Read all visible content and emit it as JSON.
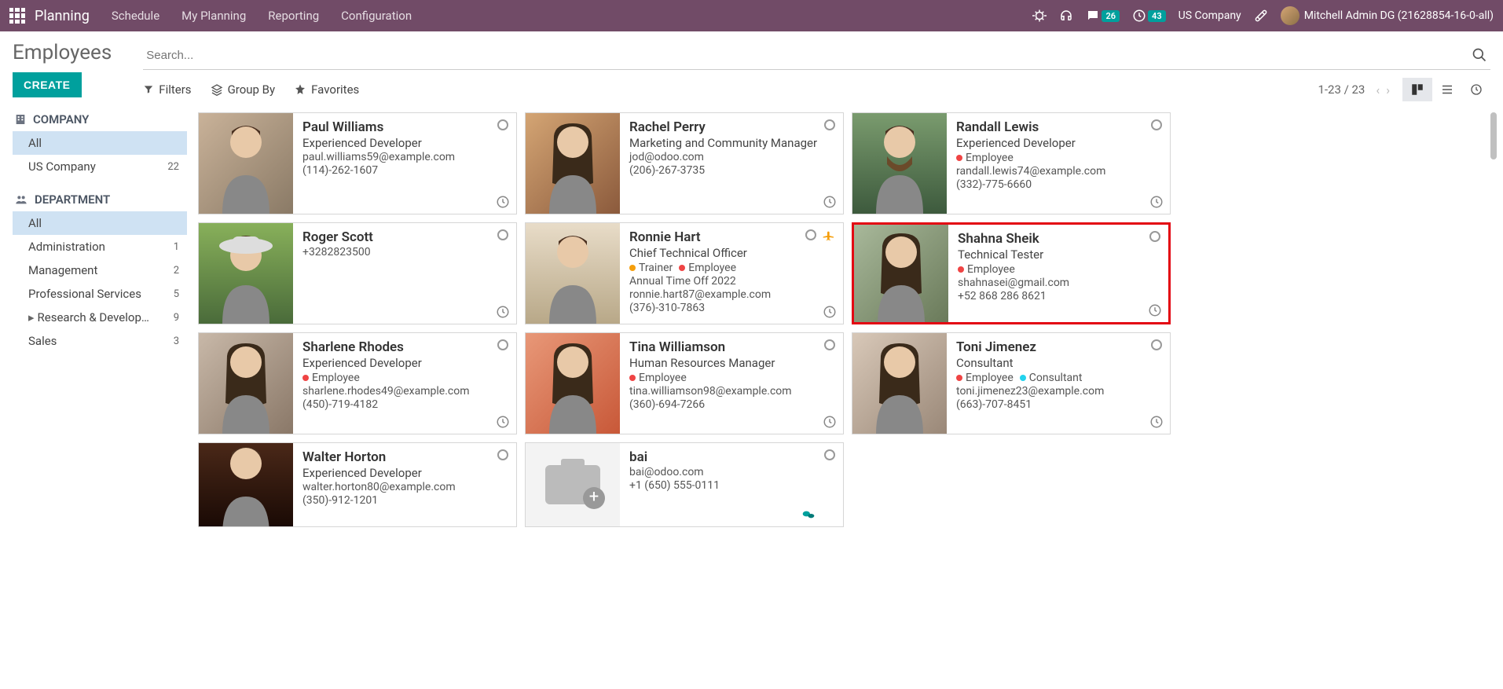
{
  "topnav": {
    "brand": "Planning",
    "menus": [
      "Schedule",
      "My Planning",
      "Reporting",
      "Configuration"
    ],
    "badge_chat": "26",
    "badge_clock": "43",
    "company": "US Company",
    "user": "Mitchell Admin DG (21628854-16-0-all)"
  },
  "page": {
    "title": "Employees",
    "create_label": "CREATE",
    "search_placeholder": "Search...",
    "filters_label": "Filters",
    "groupby_label": "Group By",
    "favorites_label": "Favorites",
    "pager": "1-23 / 23"
  },
  "sidebar": {
    "company_heading": "COMPANY",
    "company_all": "All",
    "company_items": [
      {
        "label": "US Company",
        "count": "22"
      }
    ],
    "department_heading": "DEPARTMENT",
    "department_all": "All",
    "department_items": [
      {
        "label": "Administration",
        "count": "1"
      },
      {
        "label": "Management",
        "count": "2"
      },
      {
        "label": "Professional Services",
        "count": "5"
      },
      {
        "label": "Research & Develop…",
        "count": "9",
        "expandable": true
      },
      {
        "label": "Sales",
        "count": "3"
      }
    ]
  },
  "employees": [
    {
      "name": "Paul Williams",
      "title": "Experienced Developer",
      "tags": [],
      "lines": [
        "paul.williams59@example.com",
        "(114)-262-1607"
      ],
      "highlighted": false,
      "avatar": "m1"
    },
    {
      "name": "Rachel Perry",
      "title": "Marketing and Community Manager",
      "tags": [],
      "lines": [
        "jod@odoo.com",
        "(206)-267-3735"
      ],
      "highlighted": false,
      "avatar": "f1"
    },
    {
      "name": "Randall Lewis",
      "title": "Experienced Developer",
      "tags": [
        {
          "color": "red",
          "label": "Employee"
        }
      ],
      "lines": [
        "randall.lewis74@example.com",
        "(332)-775-6660"
      ],
      "highlighted": false,
      "avatar": "m2"
    },
    {
      "name": "Roger Scott",
      "title": "",
      "tags": [],
      "lines": [
        "+3282823500"
      ],
      "highlighted": false,
      "avatar": "m3"
    },
    {
      "name": "Ronnie Hart",
      "title": "Chief Technical Officer",
      "tags": [
        {
          "color": "orange",
          "label": "Trainer"
        },
        {
          "color": "red",
          "label": "Employee"
        }
      ],
      "lines": [
        "Annual Time Off 2022",
        "ronnie.hart87@example.com",
        "(376)-310-7863"
      ],
      "highlighted": false,
      "avatar": "m4",
      "plane": true
    },
    {
      "name": "Shahna Sheik",
      "title": "Technical Tester",
      "tags": [
        {
          "color": "red",
          "label": "Employee"
        }
      ],
      "lines": [
        "shahnasei@gmail.com",
        "+52 868 286 8621"
      ],
      "highlighted": true,
      "avatar": "f2"
    },
    {
      "name": "Sharlene Rhodes",
      "title": "Experienced Developer",
      "tags": [
        {
          "color": "red",
          "label": "Employee"
        }
      ],
      "lines": [
        "sharlene.rhodes49@example.com",
        "(450)-719-4182"
      ],
      "highlighted": false,
      "avatar": "f3"
    },
    {
      "name": "Tina Williamson",
      "title": "Human Resources Manager",
      "tags": [
        {
          "color": "red",
          "label": "Employee"
        }
      ],
      "lines": [
        "tina.williamson98@example.com",
        "(360)-694-7266"
      ],
      "highlighted": false,
      "avatar": "f4"
    },
    {
      "name": "Toni Jimenez",
      "title": "Consultant",
      "tags": [
        {
          "color": "red",
          "label": "Employee"
        },
        {
          "color": "cyan",
          "label": "Consultant"
        }
      ],
      "lines": [
        "toni.jimenez23@example.com",
        "(663)-707-8451"
      ],
      "highlighted": false,
      "avatar": "f5"
    },
    {
      "name": "Walter Horton",
      "title": "Experienced Developer",
      "tags": [],
      "lines": [
        "walter.horton80@example.com",
        "(350)-912-1201"
      ],
      "highlighted": false,
      "avatar": "m5",
      "cut": true
    },
    {
      "name": "bai",
      "title": "",
      "tags": [],
      "lines": [
        "bai@odoo.com",
        "+1 (650) 555-0111"
      ],
      "highlighted": false,
      "avatar": "placeholder",
      "cut": true,
      "chat": true
    }
  ]
}
